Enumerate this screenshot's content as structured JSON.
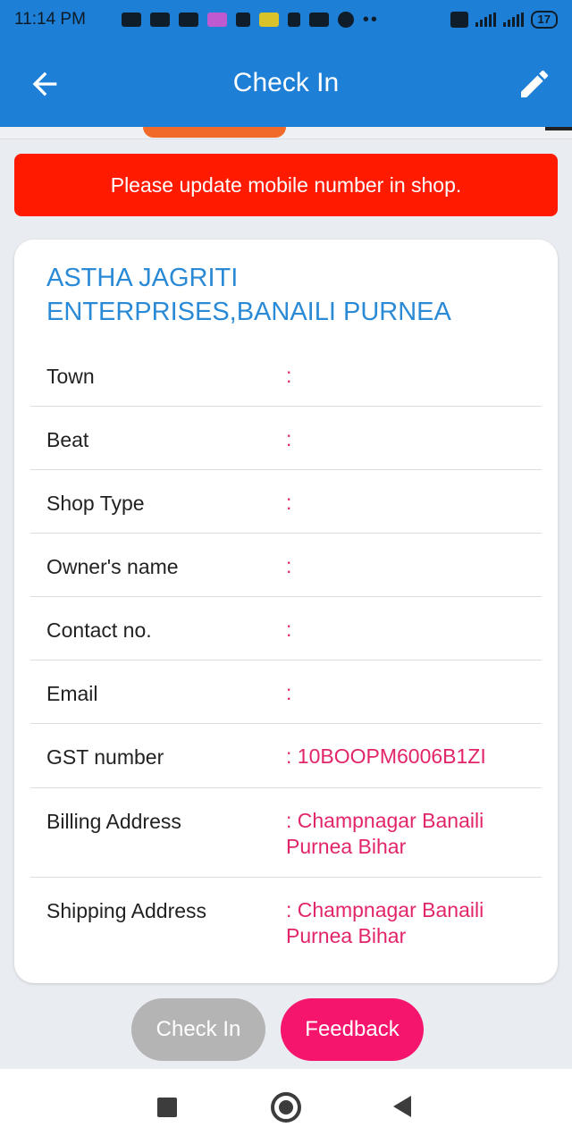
{
  "status_bar": {
    "time": "11:14 PM",
    "battery": "17",
    "network": "4G",
    "volte": "Vo LTE",
    "app_icons": [
      "youtube-icon",
      "youtube-icon",
      "youtube-icon",
      "app-icon",
      "app-icon",
      "ludo-icon",
      "tiktok-icon",
      "gmail-icon",
      "location-icon"
    ]
  },
  "app_bar": {
    "title": "Check In",
    "back_icon": "arrow-back-icon",
    "edit_icon": "pencil-icon"
  },
  "alert": {
    "message": "Please update mobile number in shop.",
    "color": "#ff1a00"
  },
  "shop": {
    "name": "ASTHA JAGRITI ENTERPRISES,BANAILI PURNEA",
    "details": [
      {
        "label": "Town",
        "value": ":"
      },
      {
        "label": "Beat",
        "value": ":"
      },
      {
        "label": "Shop Type",
        "value": ":"
      },
      {
        "label": "Owner's name",
        "value": ":"
      },
      {
        "label": "Contact no.",
        "value": ":"
      },
      {
        "label": "Email",
        "value": ":"
      },
      {
        "label": "GST number",
        "value": ": 10BOOPM6006B1ZI"
      },
      {
        "label": "Billing Address",
        "value": ": Champnagar Banaili Purnea Bihar"
      },
      {
        "label": "Shipping Address",
        "value": ": Champnagar Banaili Purnea Bihar"
      }
    ]
  },
  "actions": {
    "checkin_label": "Check In",
    "feedback_label": "Feedback"
  },
  "colors": {
    "primary": "#1e7fd6",
    "accent": "#f5156c",
    "value_text": "#e2256a",
    "shop_name": "#2a8ad6"
  },
  "nav_bar": {
    "recent_icon": "square-icon",
    "home_icon": "circle-icon",
    "back_icon": "triangle-back-icon"
  }
}
